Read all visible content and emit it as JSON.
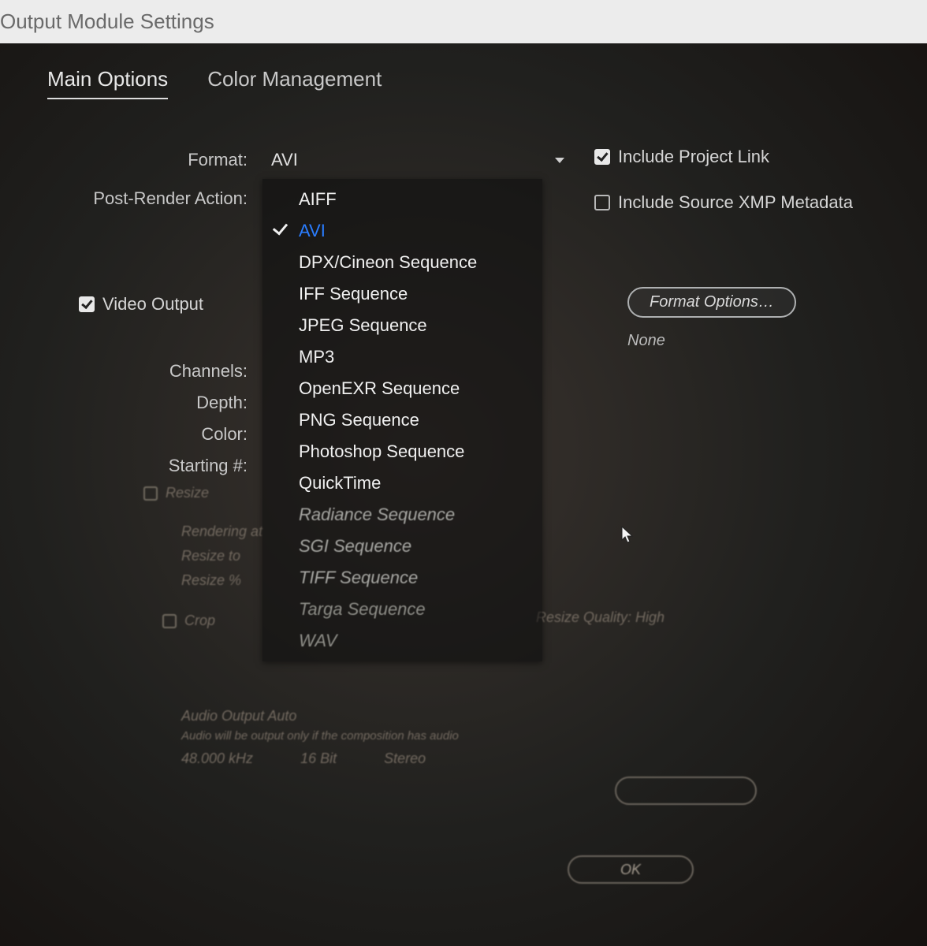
{
  "window": {
    "title": "Output Module Settings"
  },
  "tabs": {
    "main": "Main Options",
    "color": "Color Management"
  },
  "labels": {
    "format": "Format:",
    "postRender": "Post-Render Action:",
    "videoOutput": "Video Output",
    "channels": "Channels:",
    "depth": "Depth:",
    "color": "Color:",
    "starting": "Starting #:",
    "resize": "Resize",
    "crop": "Crop",
    "renderingAt": "Rendering at",
    "resizeTo": "Resize to",
    "resizePct": "Resize %",
    "resizeQuality": "Resize Quality: High",
    "audioOutput": "Audio Output Auto",
    "audioHint": "Audio will be output only if the composition has audio",
    "audioRate": "48.000 kHz",
    "audioBit": "16 Bit",
    "audioCh": "Stereo"
  },
  "format": {
    "selected": "AVI",
    "options": [
      "AIFF",
      "AVI",
      "DPX/Cineon Sequence",
      "IFF Sequence",
      "JPEG Sequence",
      "MP3",
      "OpenEXR Sequence",
      "PNG Sequence",
      "Photoshop Sequence",
      "QuickTime",
      "Radiance Sequence",
      "SGI Sequence",
      "TIFF Sequence",
      "Targa Sequence",
      "WAV"
    ]
  },
  "right": {
    "includeProjectLink": "Include Project Link",
    "includeXMP": "Include Source XMP Metadata",
    "formatOptions": "Format Options…",
    "none": "None",
    "ok": "OK"
  }
}
